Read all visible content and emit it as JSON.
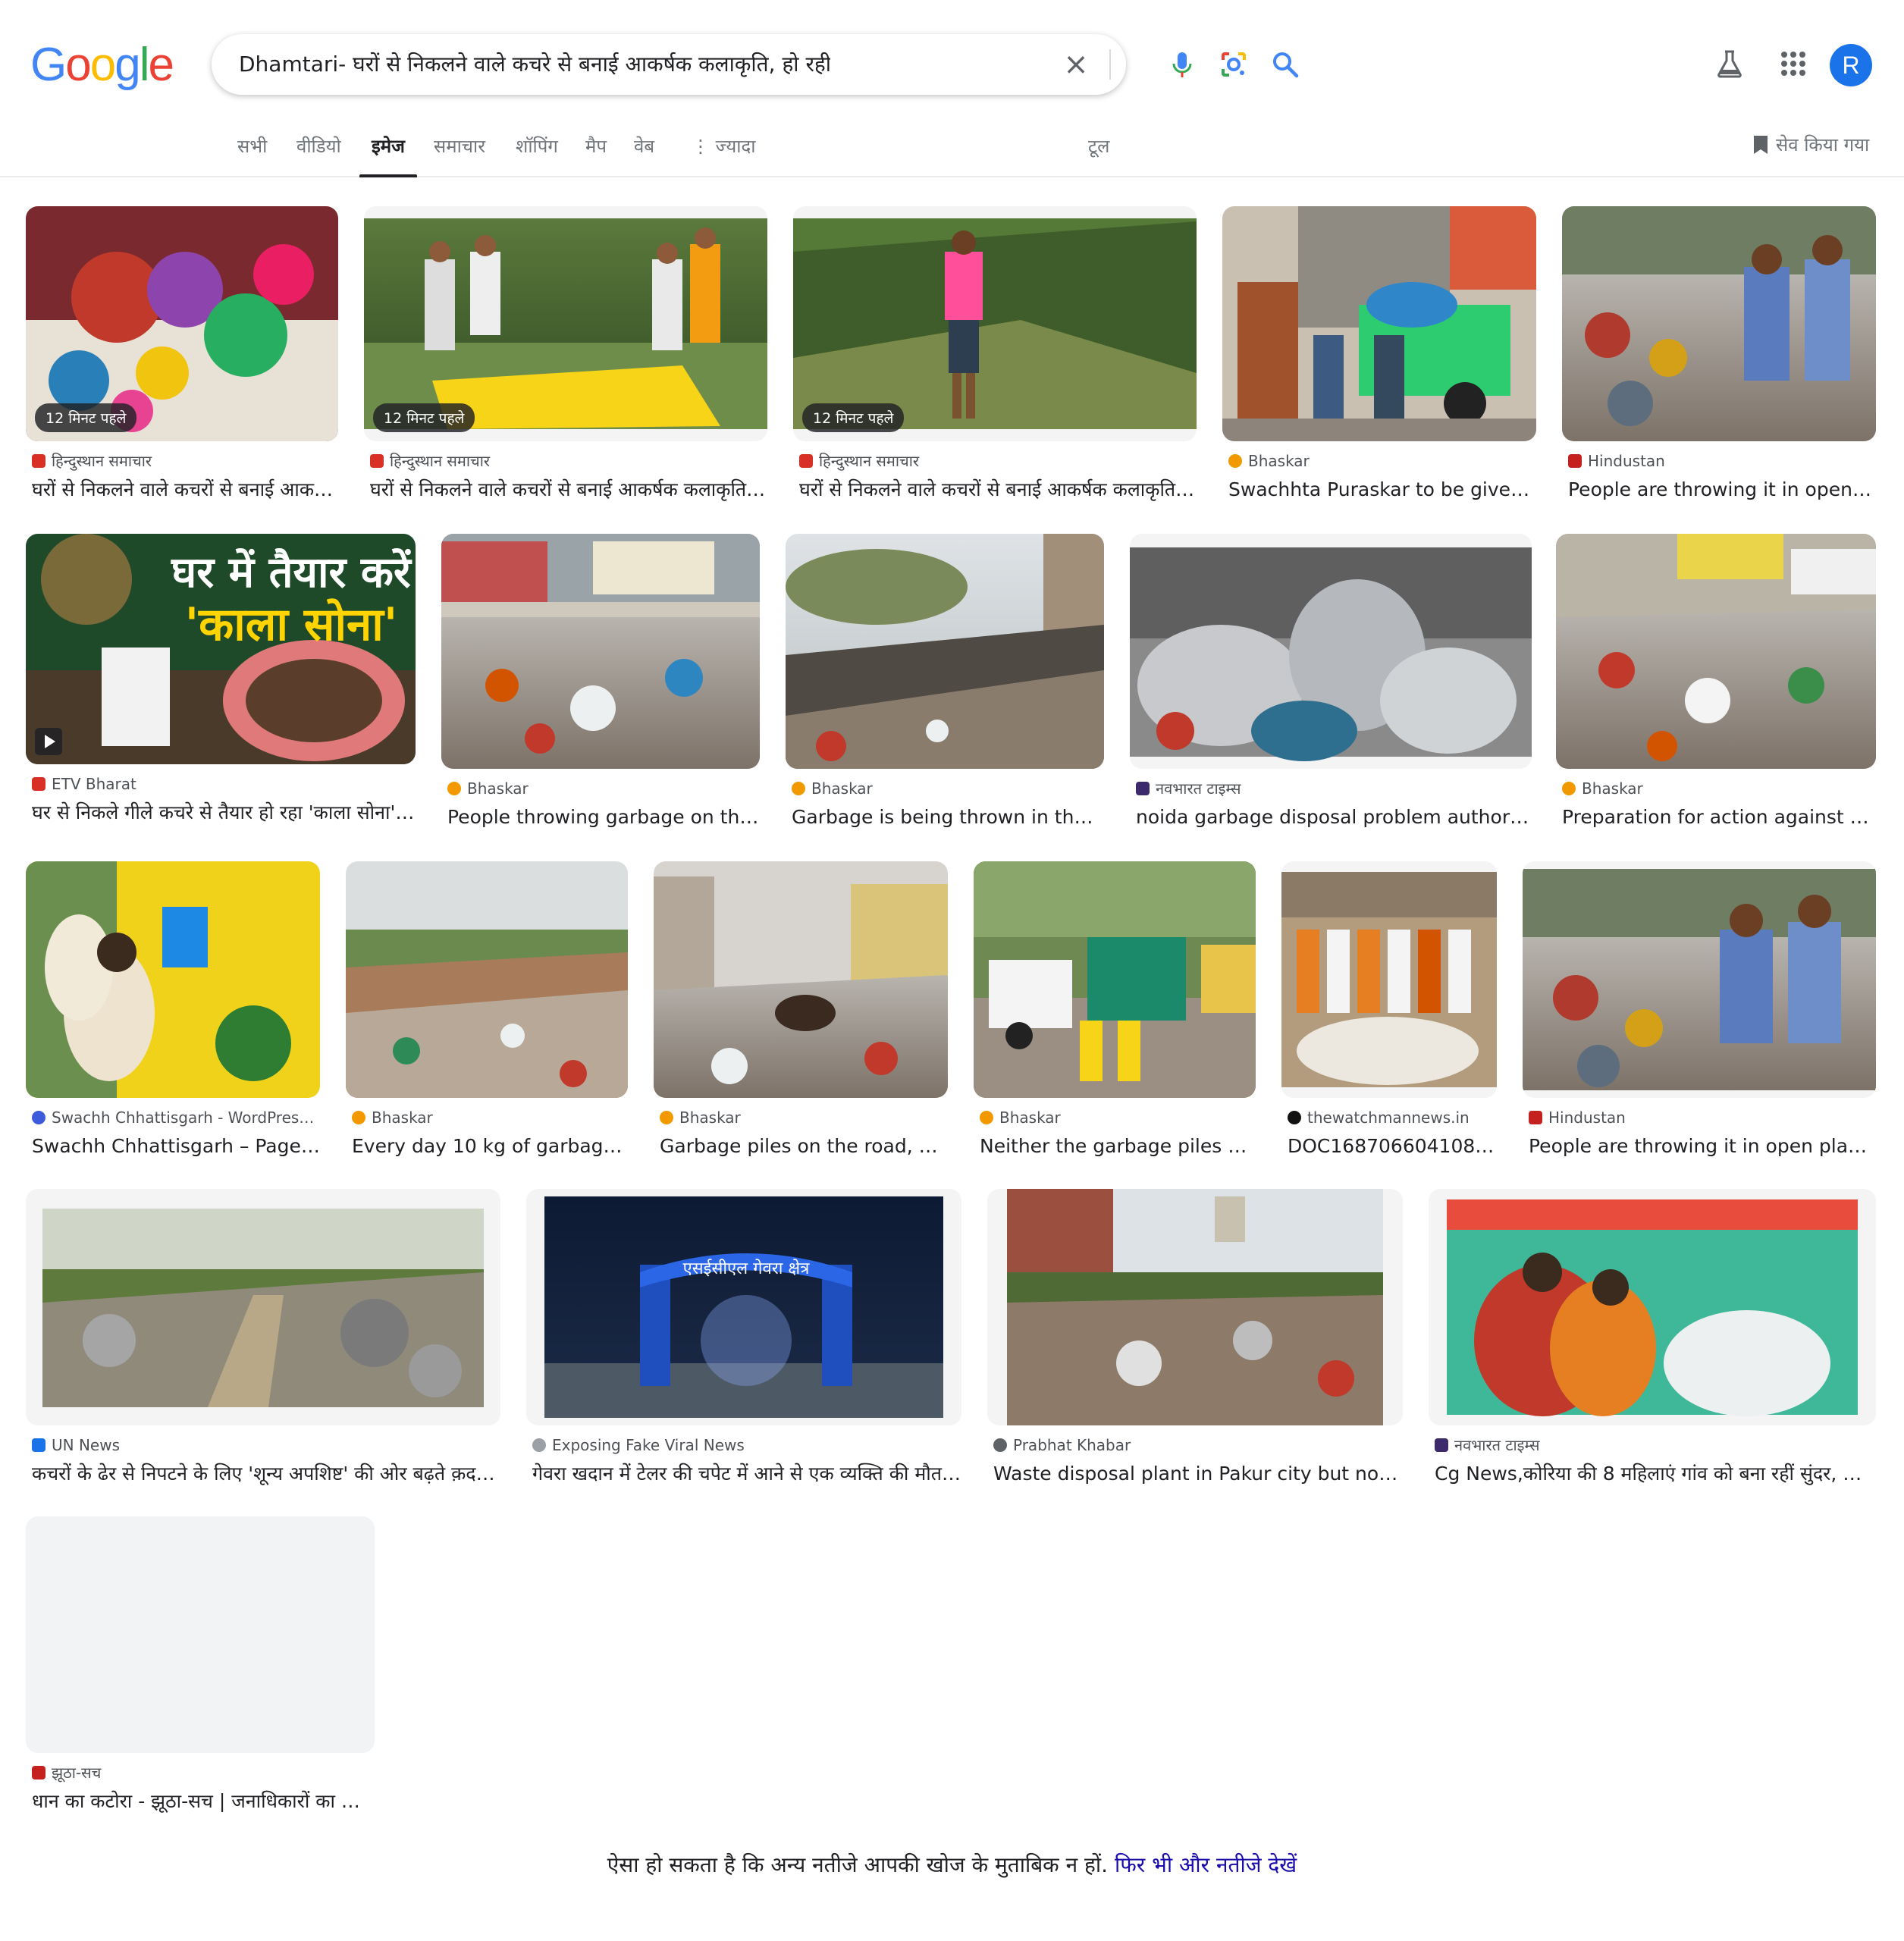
{
  "search": {
    "query": "Dhamtari- घरों से निकलने वाले कचरे से बनाई आकर्षक कलाकृति, हो रही सर"
  },
  "logo": [
    "G",
    "o",
    "o",
    "g",
    "l",
    "e"
  ],
  "logo_colors": [
    "#4285F4",
    "#EA4335",
    "#FBBC05",
    "#4285F4",
    "#34A853",
    "#EA4335"
  ],
  "user_initial": "R",
  "tabs": [
    "सभी",
    "वीडियो",
    "इमेज",
    "समाचार",
    "शॉपिंग",
    "मैप",
    "वेब",
    "ज्यादा"
  ],
  "tools_label": "टूल",
  "saved_label": "सेव किया गया",
  "icons": {
    "clear": "close-icon",
    "mic": "microphone-icon",
    "lens": "lens-icon",
    "search": "search-icon",
    "labs": "flask-icon",
    "apps": "apps-grid-icon",
    "more": "more-vertical-icon",
    "saved": "bookmark-icon",
    "play": "play-icon"
  },
  "results": [
    {
      "source": "हिन्दुस्थान समाचार",
      "title": "घरों से निकलने वाले कचरों से बनाई आक…",
      "badge": "12 मिनट पहले",
      "fav": "#d93025"
    },
    {
      "source": "हिन्दुस्थान समाचार",
      "title": "घरों से निकलने वाले कचरों से बनाई आकर्षक कलाकृति…",
      "badge": "12 मिनट पहले",
      "fav": "#d93025"
    },
    {
      "source": "हिन्दुस्थान समाचार",
      "title": "घरों से निकलने वाले कचरों से बनाई आकर्षक कलाकृति…",
      "badge": "12 मिनट पहले",
      "fav": "#d93025"
    },
    {
      "source": "Bhaskar",
      "title": "Swachhta Puraskar to be given t…",
      "fav": "#f29900"
    },
    {
      "source": "Hindustan",
      "title": "People are throwing it in open pl…",
      "fav": "#c5221f"
    },
    {
      "source": "ETV Bharat",
      "title": "घर से निकले गीले कचरे से तैयार हो रहा 'काला सोना'…",
      "fav": "#d93025"
    },
    {
      "source": "Bhaskar",
      "title": "People throwing garbage on the s…",
      "fav": "#f29900"
    },
    {
      "source": "Bhaskar",
      "title": "Garbage is being thrown in the op…",
      "fav": "#f29900"
    },
    {
      "source": "नवभारत टाइम्स",
      "title": "noida garbage disposal problem authority is…",
      "fav": "#3c2a6b"
    },
    {
      "source": "Bhaskar",
      "title": "Preparation for action against tho…",
      "fav": "#f29900"
    },
    {
      "source": "Swachh Chhattisgarh - WordPres…",
      "title": "Swachh Chhattisgarh – Page 2…",
      "fav": "#3b5bdb"
    },
    {
      "source": "Bhaskar",
      "title": "Every day 10 kg of garbage is…",
      "fav": "#f29900"
    },
    {
      "source": "Bhaskar",
      "title": "Garbage piles on the road, drai…",
      "fav": "#f29900"
    },
    {
      "source": "Bhaskar",
      "title": "Neither the garbage piles are …",
      "fav": "#f29900"
    },
    {
      "source": "thewatchmannews.in",
      "title": "DOC1687066041085…",
      "fav": "#111111"
    },
    {
      "source": "Hindustan",
      "title": "People are throwing it in open places i…",
      "fav": "#c5221f"
    },
    {
      "source": "UN News",
      "title": "कचरों के ढेर से निपटने के लिए 'शून्य अपशिष्ट' की ओर बढ़ते क़दम…",
      "fav": "#1a73e8"
    },
    {
      "source": "Exposing Fake Viral News",
      "title": "गेवरा खदान में टेलर की चपेट में आने से एक व्यक्ति की मौत, …",
      "fav": "#9aa0a6"
    },
    {
      "source": "Prabhat Khabar",
      "title": "Waste disposal plant in Pakur city but not bei…",
      "fav": "#5f6368"
    },
    {
      "source": "नवभारत टाइम्स",
      "title": "Cg News,कोरिया की 8 महिलाएं गांव को बना रहीं सुंदर, अब…",
      "fav": "#3c2a6b"
    },
    {
      "source": "झूठा-सच",
      "title": "धान का कटोरा - झूठा-सच | जनाधिकारों का नि…",
      "fav": "#c5221f"
    }
  ],
  "thumb_text": {
    "etv_line1": "घर में तैयार करें",
    "etv_line2": "'काला सोना'",
    "gevra_sign": "एसईसीएल गेवरा क्षेत्र"
  },
  "footer": {
    "text": "ऐसा हो सकता है कि अन्य नतीजे आपकी खोज के मुताबिक न हों.",
    "link": "फिर भी और नतीजे देखें"
  }
}
